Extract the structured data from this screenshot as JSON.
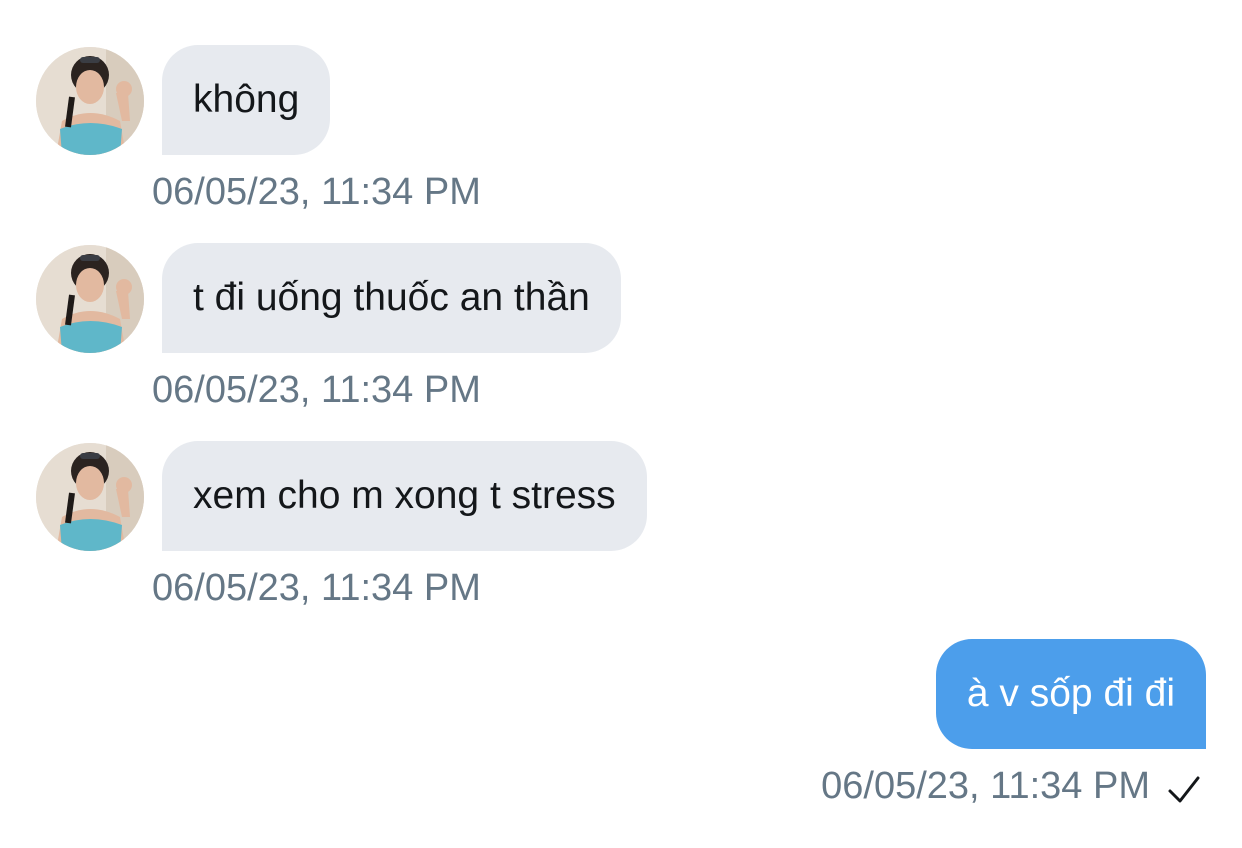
{
  "conversation": {
    "incoming": [
      {
        "text": "không",
        "time": "06/05/23, 11:34 PM",
        "avatar_icon": "user-avatar"
      },
      {
        "text": "t đi uống thuốc an thần",
        "time": "06/05/23, 11:34 PM",
        "avatar_icon": "user-avatar"
      },
      {
        "text": "xem cho m xong t stress",
        "time": "06/05/23, 11:34 PM",
        "avatar_icon": "user-avatar"
      }
    ],
    "outgoing": [
      {
        "text": "à v sốp đi đi",
        "time": "06/05/23, 11:34 PM",
        "status_icon": "checkmark-icon"
      }
    ]
  },
  "colors": {
    "incoming_bubble": "#e7eaef",
    "outgoing_bubble": "#4c9eeb",
    "timestamp": "#657786",
    "text": "#14171a"
  }
}
